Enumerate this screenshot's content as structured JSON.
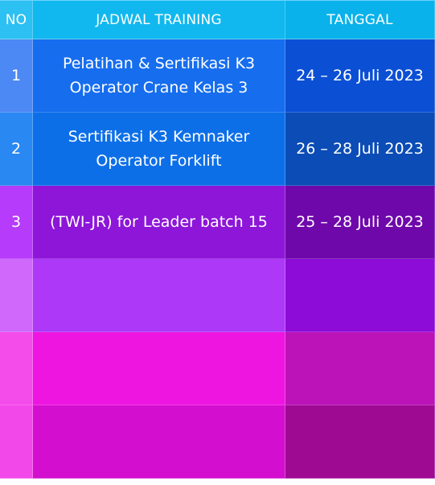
{
  "table": {
    "headers": {
      "no": "NO",
      "training": "JADWAL TRAINING",
      "date": "TANGGAL"
    },
    "rows": [
      {
        "no": "1",
        "training": "Pelatihan & Sertifikasi K3\nOperator Crane Kelas 3",
        "date": "24 – 26 Juli 2023"
      },
      {
        "no": "2",
        "training": "Sertifikasi K3 Kemnaker\nOperator Forklift",
        "date": "26 – 28 Juli 2023"
      },
      {
        "no": "3",
        "training": "(TWI-JR) for Leader batch 15",
        "date": "25 – 28 Juli 2023"
      },
      {
        "no": "",
        "training": "",
        "date": ""
      },
      {
        "no": "",
        "training": "",
        "date": ""
      },
      {
        "no": "",
        "training": "",
        "date": ""
      }
    ]
  }
}
